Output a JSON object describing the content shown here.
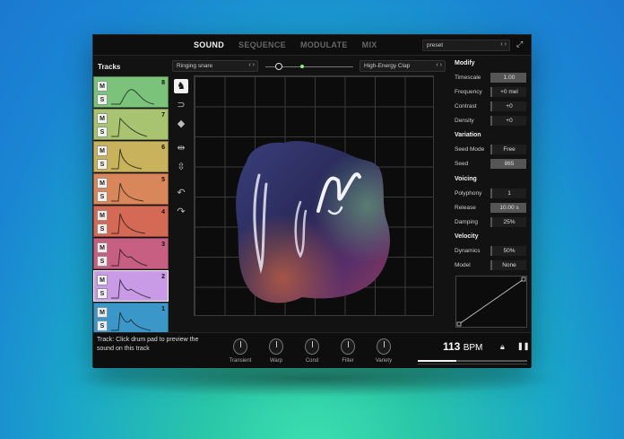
{
  "nav": {
    "tabs": [
      "SOUND",
      "SEQUENCE",
      "MODULATE",
      "MIX"
    ],
    "active": "SOUND"
  },
  "preset": {
    "label": "preset",
    "arrows": "‹ ›"
  },
  "tracks": {
    "title": "Tracks",
    "mute_label": "M",
    "solo_label": "S",
    "items": [
      {
        "number": "8",
        "color": "#7bc37a"
      },
      {
        "number": "7",
        "color": "#a9c471"
      },
      {
        "number": "6",
        "color": "#c8b25c"
      },
      {
        "number": "5",
        "color": "#d9875a"
      },
      {
        "number": "4",
        "color": "#d46a55"
      },
      {
        "number": "3",
        "color": "#c65f82"
      },
      {
        "number": "2",
        "color": "#c99be6"
      },
      {
        "number": "1",
        "color": "#3a97c7"
      }
    ]
  },
  "sound": {
    "left_select": "Ringing snare",
    "right_select": "High-Energy Clap",
    "arrows": "‹ ›",
    "morph_position": 0.15
  },
  "tools": [
    "brush-icon",
    "magnet-icon",
    "eraser-icon",
    "flip-horizontal-icon",
    "flip-vertical-icon",
    "undo-icon",
    "redo-icon"
  ],
  "panel": {
    "modify": {
      "title": "Modify",
      "rows": [
        {
          "label": "Timescale",
          "value": "1.00"
        },
        {
          "label": "Frequency",
          "value": "+0 mel"
        },
        {
          "label": "Contrast",
          "value": "+0"
        },
        {
          "label": "Density",
          "value": "+0"
        }
      ]
    },
    "variation": {
      "title": "Variation",
      "rows": [
        {
          "label": "Seed Mode",
          "value": "Free"
        },
        {
          "label": "Seed",
          "value": "865"
        }
      ]
    },
    "voicing": {
      "title": "Voicing",
      "rows": [
        {
          "label": "Polyphony",
          "value": "1"
        },
        {
          "label": "Release",
          "value": "10.00 s"
        },
        {
          "label": "Damping",
          "value": "25%"
        }
      ]
    },
    "velocity": {
      "title": "Velocity",
      "rows": [
        {
          "label": "Dynamics",
          "value": "50%"
        },
        {
          "label": "Model",
          "value": "None"
        }
      ]
    }
  },
  "footer": {
    "hint": "Track: Click drum pad to preview the sound on this track",
    "knobs": [
      "Transient",
      "Warp",
      "Cond",
      "Filter",
      "Variety"
    ],
    "bpm_value": "113",
    "bpm_unit": "BPM",
    "progress": 0.35
  }
}
